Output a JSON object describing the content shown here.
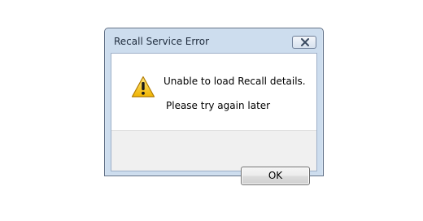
{
  "dialog": {
    "title": "Recall Service Error",
    "close_icon": "close-icon",
    "message_icon": "warning-icon",
    "message_line1": "Unable to load Recall details.",
    "message_line2": "Please try again later",
    "ok_label": "OK"
  },
  "colors": {
    "frame": "#cdddee",
    "footer": "#f0f0f0",
    "warning_yellow": "#f6c400"
  }
}
